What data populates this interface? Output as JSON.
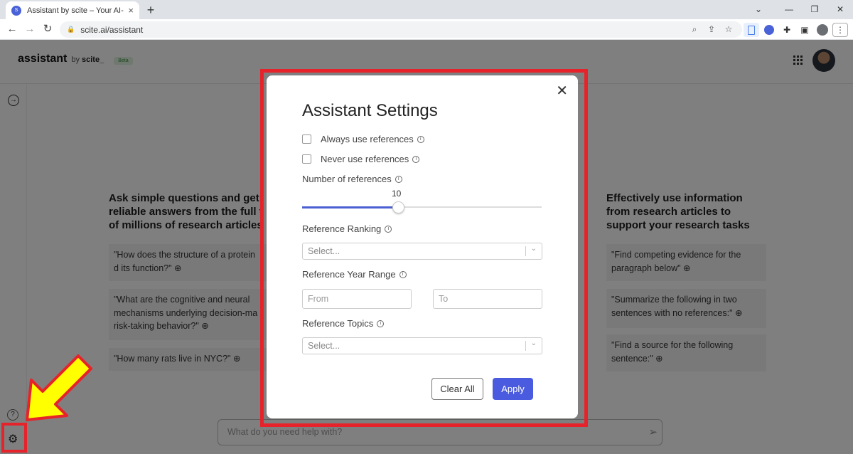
{
  "browser": {
    "tab_title": "Assistant by scite – Your AI-Powe",
    "tab_favicon_text": "S",
    "url": "scite.ai/assistant"
  },
  "header": {
    "brand": "assistant",
    "by": "by",
    "scite": "scite_",
    "badge": "Beta"
  },
  "left_column": {
    "heading": "Ask simple questions and get reliable answers from the full t of millions of research articles",
    "prompts": [
      "\"How does the structure of a protein d its function?\" ⊕",
      "\"What are the cognitive and neural mechanisms underlying decision-ma risk-taking behavior?\" ⊕",
      "\"How many rats live in NYC?\" ⊕"
    ]
  },
  "right_column": {
    "heading": "Effectively use information from research articles to support your research tasks",
    "prompts": [
      "\"Find competing evidence for the paragraph below\" ⊕",
      "\"Summarize the following in two sentences with no references:\" ⊕",
      "\"Find a source for the following sentence:\" ⊕"
    ]
  },
  "chat": {
    "placeholder": "What do you need help with?"
  },
  "modal": {
    "title": "Assistant Settings",
    "always_refs": "Always use references",
    "never_refs": "Never use references",
    "num_refs_label": "Number of references",
    "num_refs_value": "10",
    "num_refs_fraction": 0.4,
    "ranking_label": "Reference Ranking",
    "ranking_placeholder": "Select...",
    "year_label": "Reference Year Range",
    "from_placeholder": "From",
    "to_placeholder": "To",
    "topics_label": "Reference Topics",
    "topics_placeholder": "Select...",
    "clear_label": "Clear All",
    "apply_label": "Apply"
  },
  "colors": {
    "accent": "#4a5be0",
    "annotation": "#e6232a",
    "arrow": "#ffff00"
  }
}
